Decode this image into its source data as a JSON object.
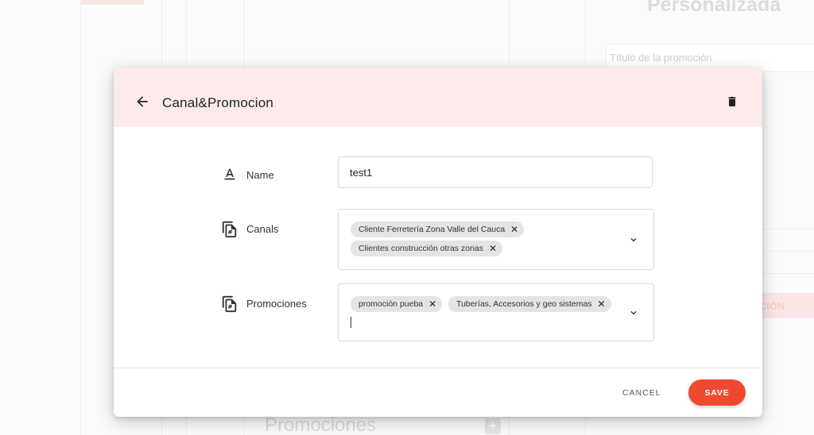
{
  "background": {
    "heading": "Personalizada",
    "title_placeholder": "Título de la promoción",
    "action_button": "CIÓN",
    "bottom_heading": "Promociones"
  },
  "dialog": {
    "title": "Canal&Promocion",
    "header_color": "#fcebea",
    "back_icon": "arrow-left-icon",
    "delete_icon": "trash-icon",
    "fields": {
      "name": {
        "label": "Name",
        "icon": "text-format-icon",
        "value": "test1"
      },
      "canals": {
        "label": "Canals",
        "icon": "file-copy-icon",
        "selected": [
          "Cliente Ferretería Zona Valle del Cauca",
          "Clientes construcción otras zonas"
        ]
      },
      "promociones": {
        "label": "Promociones",
        "icon": "file-copy-icon",
        "selected": [
          "promoción pueba",
          "Tuberías, Accesorios y geo sistemas"
        ]
      }
    },
    "footer": {
      "cancel_label": "CANCEL",
      "save_label": "SAVE",
      "save_color": "#ef4a2f"
    }
  }
}
